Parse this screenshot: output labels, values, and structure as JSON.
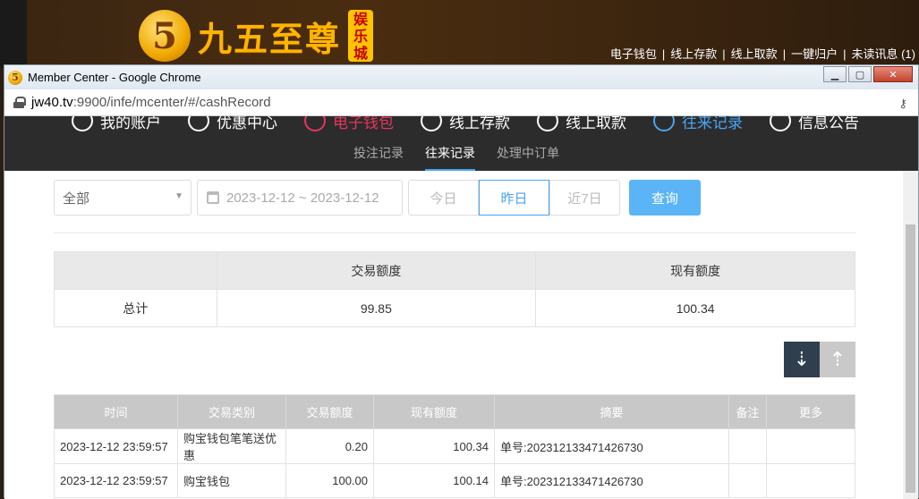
{
  "site": {
    "logo_glyph": "5",
    "logo_text": "九五至尊",
    "logo_badge": [
      "娱",
      "乐",
      "城"
    ],
    "top_links": [
      "电子钱包",
      "线上存款",
      "线上取款",
      "一键归户",
      "未读讯息 (1)"
    ]
  },
  "window": {
    "title": "Member Center - Google Chrome",
    "url_host": "jw40.tv",
    "url_rest": ":9900/infe/mcenter/#/cashRecord",
    "btn_min": "▁",
    "btn_max": "▢",
    "btn_close": "✕"
  },
  "nav": {
    "items": [
      "我的账户",
      "优惠中心",
      "电子钱包",
      "线上存款",
      "线上取款",
      "往来记录",
      "信息公告"
    ],
    "subtabs": [
      "投注记录",
      "往来记录",
      "处理中订单"
    ]
  },
  "filter": {
    "select_value": "全部",
    "date_range": "2023-12-12 ~ 2023-12-12",
    "quick": [
      "今日",
      "昨日",
      "近7日"
    ],
    "query_label": "查询"
  },
  "summary": {
    "headers": [
      "",
      "交易额度",
      "现有额度"
    ],
    "row": [
      "总计",
      "99.85",
      "100.34"
    ]
  },
  "records": {
    "headers": [
      "时间",
      "交易类别",
      "交易额度",
      "现有额度",
      "摘要",
      "备注",
      "更多"
    ],
    "rows": [
      [
        "2023-12-12 23:59:57",
        "购宝钱包笔笔送优惠",
        "0.20",
        "100.34",
        "单号:202312133471426730",
        "",
        ""
      ],
      [
        "2023-12-12 23:59:57",
        "购宝钱包",
        "100.00",
        "100.14",
        "单号:202312133471426730",
        "",
        ""
      ]
    ]
  },
  "colors": {
    "accent": "#4aa3f0",
    "nav_active_red": "#e8345c",
    "header_bg": "#2c2c2c"
  }
}
